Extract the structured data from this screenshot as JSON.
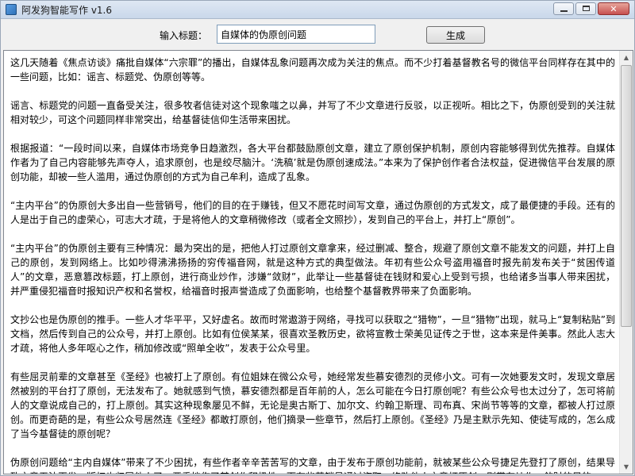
{
  "window": {
    "title": "阿发狗智能写作 v1.6",
    "icons": {
      "app": "dog-app-icon",
      "minimize": "minimize-icon",
      "maximize": "maximize-icon",
      "close": "close-icon"
    },
    "close_glyph": "✕"
  },
  "toolbar": {
    "label": "输入标题：",
    "input_value": "自媒体的伪原创问题",
    "generate_label": "生成"
  },
  "article": {
    "paragraphs": [
      "这几天随着《焦点访谈》痛批自媒体“六宗罪”的播出，自媒体乱象问题再次成为关注的焦点。而不少打着基督教名号的微信平台同样存在其中的一些问题，比如：谣言、标题党、伪原创等等。",
      "谣言、标题党的问题一直备受关注，很多牧者信徒对这个现象嗤之以鼻，并写了不少文章进行反驳，以正视听。相比之下，伪原创受到的关注就相对较少，可这个问题同样非常突出，给基督徒信仰生活带来困扰。",
      "根据报道：“一段时间以来，自媒体市场竞争日趋激烈，各大平台都鼓励原创文章，建立了原创保护机制，原创内容能够得到优先推荐。自媒体作者为了自己内容能够先声夺人，追求原创，也是绞尽脑汁。‘洗稿’就是伪原创速成法。”本来为了保护创作者合法权益，促进微信平台发展的原创功能，却被一些人滥用，通过伪原创的方式为自己牟利，造成了乱象。",
      "“主内平台”的伪原创大多出自一些营销号，他们的目的在于赚钱，但又不愿花时间写文章，通过伪原创的方式发文，成了最便捷的手段。还有的人是出于自己的虚荣心，可志大才疏，于是将他人的文章稍微修改（或者全文照抄），发到自己的平台上，并打上“原创”。",
      "“主内平台”的伪原创主要有三种情况：最为突出的是，把他人打过原创文章拿来，经过删减、整合，规避了原创文章不能发文的问题，并打上自己的原创，发到网络上。比如吵得沸沸扬扬的穷传福音网，就是这种方式的典型做法。年初有些公众号盗用福音时报先前发布关于“贫困传道人”的文章，恶意篡改标题，打上原创，进行商业炒作，涉嫌“敛财”，此举让一些基督徒在钱财和爱心上受到亏损，也给诸多当事人带来困扰，并严重侵犯福音时报知识产权和名誉权，给福音时报声誉造成了负面影响，也给整个基督教界带来了负面影响。",
      "文抄公也是伪原创的推手。一些人才华平平，又好虚名。故而时常遨游于网络，寻找可以获取之“猎物”，一旦“猎物”出现，就马上“复制粘贴”到文档，然后传到自己的公众号，并打上原创。比如有位侯某某，很喜欢圣教历史，欲将宣教士荣美见证传之于世，这本来是件美事。然此人志大才疏，将他人多年呕心之作，稍加修改或“照单全收”，发表于公众号里。",
      "有些屈灵前辈的文章甚至《圣经》也被打上了原创。有位姐妹在微公众号，她经常发些慕安德烈的灵修小文。可有一次她要发文时，发现文章居然被别的平台打了原创，无法发布了。她就感到气愤，慕安德烈都是百年前的人，怎么可能在今日打原创呢？有些公众号也太过分了，怎可将前人的文章说成自己的，打上原创。其实这种现象屡见不鲜，无论是奥古斯丁、加尔文、约翰卫斯理、司布真、宋尚节等等的文章，都被人打过原创。而更奇葩的是，有些公众号居然连《圣经》都敢打原创，他们摘录一些章节，然后打上原创。《圣经》乃是主默示先知、使徒写成的，怎么成了当今基督徒的原创呢？",
      "伪原创问题给“主内自媒体”带来了不少困扰，有些作者辛辛苦苦写的文章，由于发布于原创功能前，就被某些公众号捷足先登打了原创，结果导致文章无法再发，版权也归属他人了，严重挫伤了其创作积极性。而有些营销号通过盗取、修改他人文章打原创，则带有炒作、敛财的目的，"
    ]
  },
  "scrollbar": {
    "up_glyph": "▲",
    "down_glyph": "▼"
  }
}
